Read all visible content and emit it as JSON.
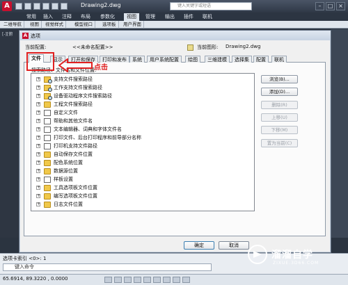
{
  "app": {
    "title": "Drawing2.dwg",
    "search_placeholder": "键入关键字或短语",
    "window_buttons": [
      "–",
      "□",
      "×"
    ]
  },
  "ribbon": {
    "tabs": [
      "常用",
      "插入",
      "注释",
      "布局",
      "参数化",
      "视图",
      "管理",
      "输出",
      "插件",
      "联机"
    ],
    "active_tab": "视图",
    "sub_tabs": [
      "二维导航",
      "视图",
      "视觉样式",
      "模型视口",
      "选项板",
      "用户界面"
    ]
  },
  "canvas": {
    "label": "[-][俯"
  },
  "dialog": {
    "title": "选项",
    "current_profile_label": "当前配置:",
    "current_profile_value": "<<未命名配置>>",
    "current_drawing_label": "当前图形:",
    "current_drawing_value": "Drawing2.dwg",
    "tabs": [
      "文件",
      "显示",
      "打开和保存",
      "打印和发布",
      "系统",
      "用户系统配置",
      "绘图",
      "三维建模",
      "选择集",
      "配置",
      "联机"
    ],
    "active_tab": "文件",
    "search_label": "搜索路径、文件名和文件位置:",
    "tree_items": [
      {
        "label": "支持文件搜索路径",
        "icon": "folder-search-icon"
      },
      {
        "label": "工作支持文件搜索路径",
        "icon": "folder-search-icon"
      },
      {
        "label": "设备驱动程序文件搜索路径",
        "icon": "folder-search-icon"
      },
      {
        "label": "工程文件搜索路径",
        "icon": "folder-icon"
      },
      {
        "label": "自定义文件",
        "icon": "document-icon"
      },
      {
        "label": "帮助和其他文件名",
        "icon": "document-icon"
      },
      {
        "label": "文本编辑器、词典和字体文件名",
        "icon": "document-icon"
      },
      {
        "label": "打印文件、后台打印程序和前导部分名称",
        "icon": "document-icon"
      },
      {
        "label": "打印机支持文件路径",
        "icon": "document-icon"
      },
      {
        "label": "自动保存文件位置",
        "icon": "folder-icon"
      },
      {
        "label": "配色系统位置",
        "icon": "folder-icon"
      },
      {
        "label": "数据源位置",
        "icon": "folder-icon"
      },
      {
        "label": "样板设置",
        "icon": "document-icon"
      },
      {
        "label": "工具选项板文件位置",
        "icon": "folder-icon"
      },
      {
        "label": "编写选项板文件位置",
        "icon": "folder-icon"
      },
      {
        "label": "日志文件位置",
        "icon": "folder-icon"
      }
    ],
    "side_buttons": [
      {
        "label": "浏览(B)...",
        "enabled": true
      },
      {
        "label": "添加(D)...",
        "enabled": true
      },
      {
        "label": "删除(R)",
        "enabled": false
      },
      {
        "label": "上移(U)",
        "enabled": false
      },
      {
        "label": "下移(M)",
        "enabled": false
      },
      {
        "label": "置为当前(C)",
        "enabled": false
      }
    ],
    "ok_label": "确定",
    "cancel_label": "取消"
  },
  "annotation": {
    "text": "点击",
    "color": "#e02020"
  },
  "command": {
    "output": "选项卡索引 <0>: 1",
    "input_placeholder": "键入命令"
  },
  "status": {
    "coords": "65.6914, 89.3220 , 0.0000"
  },
  "watermark": {
    "name": "溜溜自学",
    "url": "ZIXUE.3D66.COM"
  }
}
